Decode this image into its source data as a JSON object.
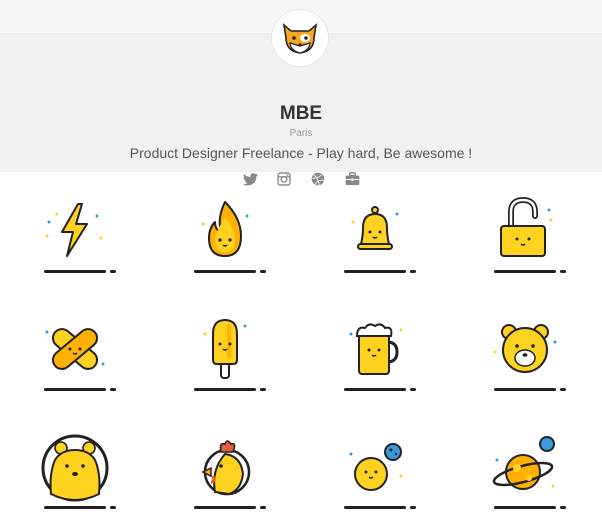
{
  "profile": {
    "name": "MBE",
    "location": "Paris",
    "bio": "Product Designer Freelance - Play hard, Be awesome !"
  },
  "socials": [
    {
      "icon": "twitter-icon"
    },
    {
      "icon": "instagram-icon"
    },
    {
      "icon": "dribbble-icon"
    },
    {
      "icon": "briefcase-icon"
    }
  ],
  "icons": [
    "lightning-icon",
    "flame-icon",
    "bell-icon",
    "padlock-icon",
    "bandage-icon",
    "popsicle-icon",
    "beer-mug-icon",
    "bear-face-icon",
    "bear-icon",
    "chicken-icon",
    "moon-icon",
    "planet-icon"
  ],
  "colors": {
    "accent_yellow": "#FFD21F",
    "outline": "#222222",
    "header_bg": "#F1F1F1"
  }
}
